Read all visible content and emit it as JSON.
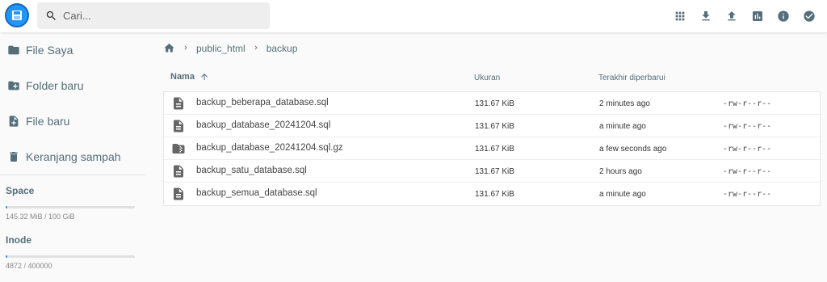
{
  "header": {
    "search_placeholder": "Cari...",
    "icons": [
      "grid-view-icon",
      "download-icon",
      "upload-icon",
      "info-chart-icon",
      "info-icon",
      "check-circle-icon"
    ]
  },
  "sidebar": {
    "items": [
      {
        "label": "File Saya",
        "icon": "folder-icon"
      },
      {
        "label": "Folder baru",
        "icon": "new-folder-icon"
      },
      {
        "label": "File baru",
        "icon": "new-file-icon"
      },
      {
        "label": "Keranjang sampah",
        "icon": "trash-icon"
      }
    ],
    "space": {
      "title": "Space",
      "value": "145.32 MiB / 100 GiB",
      "fraction": 0.0014
    },
    "inode": {
      "title": "Inode",
      "value": "4872 / 400000",
      "fraction": 0.0122
    }
  },
  "breadcrumb": {
    "items": [
      "public_html",
      "backup"
    ]
  },
  "table": {
    "headers": {
      "name": "Nama",
      "size": "Ukuran",
      "modified": "Terakhir diperbarui"
    },
    "rows": [
      {
        "name": "backup_beberapa_database.sql",
        "size": "131.67 KiB",
        "modified": "2 minutes ago",
        "perm": "-rw-r--r--",
        "type": "file"
      },
      {
        "name": "backup_database_20241204.sql",
        "size": "131.67 KiB",
        "modified": "a minute ago",
        "perm": "-rw-r--r--",
        "type": "file"
      },
      {
        "name": "backup_database_20241204.sql.gz",
        "size": "131.67 KiB",
        "modified": "a few seconds ago",
        "perm": "-rw-r--r--",
        "type": "archive"
      },
      {
        "name": "backup_satu_database.sql",
        "size": "131.67 KiB",
        "modified": "2 hours ago",
        "perm": "-rw-r--r--",
        "type": "file"
      },
      {
        "name": "backup_semua_database.sql",
        "size": "131.67 KiB",
        "modified": "a minute ago",
        "perm": "-rw-r--r--",
        "type": "file"
      }
    ]
  },
  "colors": {
    "accent": "#2196f3",
    "icon": "#546e7a",
    "fileIcon": "#666666"
  }
}
